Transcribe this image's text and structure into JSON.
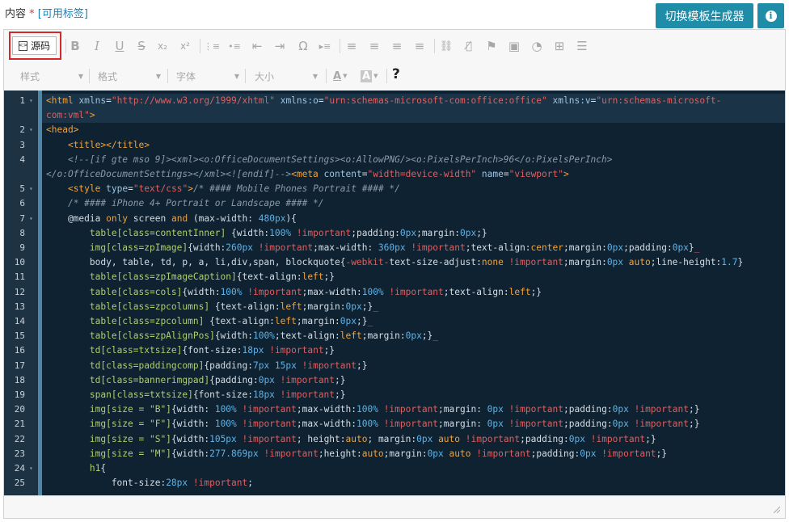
{
  "header": {
    "label": "内容",
    "required_mark": "*",
    "tags_link": "[可用标签]"
  },
  "buttons": {
    "template_generator": "切换模板生成器",
    "info_icon": "i"
  },
  "toolbar": {
    "source_label": "源码",
    "icons": [
      "B",
      "I",
      "U",
      "S",
      "x₂",
      "x²",
      "⋮≡",
      "•≡",
      "⇤",
      "⇥",
      "Ω",
      "▸≡",
      "≡",
      "≡",
      "≡",
      "≡",
      "⛓",
      "⛓̸",
      "⚑",
      "▣",
      "◔",
      "⊞",
      "☰"
    ],
    "style_placeholder": "样式",
    "format_placeholder": "格式",
    "font_placeholder": "字体",
    "size_placeholder": "大小",
    "text_color_label": "A",
    "bg_color_label": "A",
    "help_label": "?"
  },
  "code": {
    "lines": [
      {
        "n": "1",
        "fold": "▾",
        "html": "<span class=\"tag\">&lt;html</span> <span class=\"at\">xmlns</span>=<span class=\"str\">\"http://www.w3.org/1999/xhtml\"</span> <span class=\"at\">xmlns:o</span>=<span class=\"str\">\"urn:schemas-microsoft-com:office:office\"</span> <span class=\"at\">xmlns:v</span>=<span class=\"str\">\"urn:schemas-microsoft-</span>"
      },
      {
        "n": "",
        "fold": "",
        "html": "<span class=\"str\">com:vml\"</span><span class=\"tag\">&gt;</span>"
      },
      {
        "n": "2",
        "fold": "▾",
        "html": "<span class=\"tag\">&lt;head&gt;</span>"
      },
      {
        "n": "3",
        "fold": "",
        "html": "    <span class=\"tag\">&lt;title&gt;&lt;/title&gt;</span>"
      },
      {
        "n": "4",
        "fold": "",
        "html": "    <span class=\"cm\">&lt;!--[if gte mso 9]&gt;&lt;xml&gt;&lt;o:OfficeDocumentSettings&gt;&lt;o:AllowPNG/&gt;&lt;o:PixelsPerInch&gt;96&lt;/o:PixelsPerInch&gt;</span>"
      },
      {
        "n": "",
        "fold": "",
        "html": "<span class=\"cm\">&lt;/o:OfficeDocumentSettings&gt;&lt;/xml&gt;&lt;![endif]--&gt;</span><span class=\"tag\">&lt;meta</span> <span class=\"at\">content</span>=<span class=\"str\">\"width=device-width\"</span> <span class=\"at\">name</span>=<span class=\"str\">\"viewport\"</span><span class=\"tag\">&gt;</span>"
      },
      {
        "n": "5",
        "fold": "▾",
        "html": "    <span class=\"tag\">&lt;style</span> <span class=\"at\">type</span>=<span class=\"str\">\"text/css\"</span><span class=\"tag\">&gt;</span><span class=\"cm\">/* #### Mobile Phones Portrait #### */</span>"
      },
      {
        "n": "6",
        "fold": "",
        "html": "    <span class=\"cm\">/* #### iPhone 4+ Portrait or Landscape #### */</span>"
      },
      {
        "n": "7",
        "fold": "▾",
        "html": "    @media <span class=\"kw\">only</span> <span class=\"pl\">screen</span> <span class=\"kw\">and</span> (max-width: <span class=\"num\">480px</span>){"
      },
      {
        "n": "8",
        "fold": "",
        "html": "        <span class=\"sel\">table[class=contentInner]</span> {width:<span class=\"num\">100%</span> <span class=\"imp\">!important</span>;padding:<span class=\"num\">0px</span>;margin:<span class=\"num\">0px</span>;}"
      },
      {
        "n": "9",
        "fold": "",
        "html": "        <span class=\"sel\">img[class=zpImage]</span>{width:<span class=\"num\">260px</span> <span class=\"imp\">!important</span>;max-width: <span class=\"num\">360px</span> <span class=\"imp\">!important</span>;text-align:<span class=\"kw\">center</span>;margin:<span class=\"num\">0px</span>;padding:<span class=\"num\">0px</span>}<span class=\"imp\">_</span>"
      },
      {
        "n": "10",
        "fold": "",
        "html": "        body, table, td, p, a, li,div,span, blockquote{<span class=\"imp\">-webkit-</span>text-size-adjust:<span class=\"kw\">none</span> <span class=\"imp\">!important</span>;margin:<span class=\"num\">0px</span> <span class=\"kw\">auto</span>;line-height:<span class=\"num\">1.7</span>}"
      },
      {
        "n": "11",
        "fold": "",
        "html": "        <span class=\"sel\">table[class=zpImageCaption]</span>{text-align:<span class=\"kw\">left</span>;}"
      },
      {
        "n": "12",
        "fold": "",
        "html": "        <span class=\"sel\">table[class=cols]</span>{width:<span class=\"num\">100%</span> <span class=\"imp\">!important</span>;max-width:<span class=\"num\">100%</span> <span class=\"imp\">!important</span>;text-align:<span class=\"kw\">left</span>;}"
      },
      {
        "n": "13",
        "fold": "",
        "html": "        <span class=\"sel\">table[class=zpcolumns]</span> {text-align:<span class=\"kw\">left</span>;margin:<span class=\"num\">0px</span>;}<span class=\"imp\">_</span>"
      },
      {
        "n": "14",
        "fold": "",
        "html": "        <span class=\"sel\">table[class=zpcolumn]</span> {text-align:<span class=\"kw\">left</span>;margin:<span class=\"num\">0px</span>;}<span class=\"imp\">_</span>"
      },
      {
        "n": "15",
        "fold": "",
        "html": "        <span class=\"sel\">table[class=zpAlignPos]</span>{width:<span class=\"num\">100%</span>;text-align:<span class=\"kw\">left</span>;margin:<span class=\"num\">0px</span>;}<span class=\"imp\">_</span>"
      },
      {
        "n": "16",
        "fold": "",
        "html": "        <span class=\"sel\">td[class=txtsize]</span>{font-size:<span class=\"num\">18px</span> <span class=\"imp\">!important</span>;}"
      },
      {
        "n": "17",
        "fold": "",
        "html": "        <span class=\"sel\">td[class=paddingcomp]</span>{padding:<span class=\"num\">7px 15px</span> <span class=\"imp\">!important</span>;}"
      },
      {
        "n": "18",
        "fold": "",
        "html": "        <span class=\"sel\">td[class=bannerimgpad]</span>{padding:<span class=\"num\">0px</span> <span class=\"imp\">!important</span>;}"
      },
      {
        "n": "19",
        "fold": "",
        "html": "        <span class=\"sel\">span[class=txtsize]</span>{font-size:<span class=\"num\">18px</span> <span class=\"imp\">!important</span>;}"
      },
      {
        "n": "20",
        "fold": "",
        "html": "        <span class=\"sel\">img[size = \"B\"]</span>{width: <span class=\"num\">100%</span> <span class=\"imp\">!important</span>;max-width:<span class=\"num\">100%</span> <span class=\"imp\">!important</span>;margin: <span class=\"num\">0px</span> <span class=\"imp\">!important</span>;padding:<span class=\"num\">0px</span> <span class=\"imp\">!important</span>;}"
      },
      {
        "n": "21",
        "fold": "",
        "html": "        <span class=\"sel\">img[size = \"F\"]</span>{width: <span class=\"num\">100%</span> <span class=\"imp\">!important</span>;max-width:<span class=\"num\">100%</span> <span class=\"imp\">!important</span>;margin: <span class=\"num\">0px</span> <span class=\"imp\">!important</span>;padding:<span class=\"num\">0px</span> <span class=\"imp\">!important</span>;}"
      },
      {
        "n": "22",
        "fold": "",
        "html": "        <span class=\"sel\">img[size = \"S\"]</span>{width:<span class=\"num\">105px</span> <span class=\"imp\">!important</span>; height:<span class=\"kw\">auto</span>; margin:<span class=\"num\">0px</span> <span class=\"kw\">auto</span> <span class=\"imp\">!important</span>;padding:<span class=\"num\">0px</span> <span class=\"imp\">!important</span>;}"
      },
      {
        "n": "23",
        "fold": "",
        "html": "        <span class=\"sel\">img[size = \"M\"]</span>{width:<span class=\"num\">277.869px</span> <span class=\"imp\">!important</span>;height:<span class=\"kw\">auto</span>;margin:<span class=\"num\">0px</span> <span class=\"kw\">auto</span> <span class=\"imp\">!important</span>;padding:<span class=\"num\">0px</span> <span class=\"imp\">!important</span>;}"
      },
      {
        "n": "24",
        "fold": "▾",
        "html": "        <span class=\"sel\">h1</span>{"
      },
      {
        "n": "25",
        "fold": "",
        "html": "            font-size:<span class=\"num\">28px</span> <span class=\"imp\">!important</span>;"
      }
    ]
  }
}
